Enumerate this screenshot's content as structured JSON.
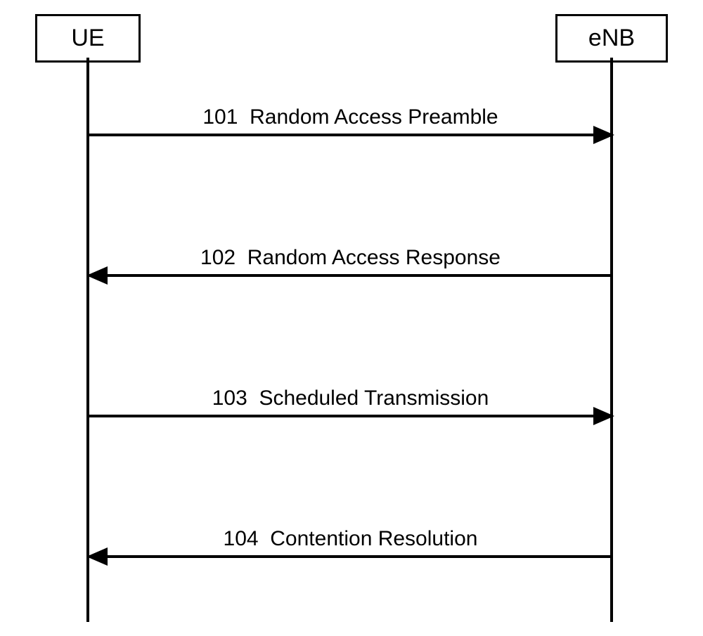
{
  "actors": {
    "ue": "UE",
    "enb": "eNB"
  },
  "messages": [
    {
      "num": "101",
      "label": "Random Access Preamble",
      "direction": "right"
    },
    {
      "num": "102",
      "label": "Random Access Response",
      "direction": "left"
    },
    {
      "num": "103",
      "label": "Scheduled Transmission",
      "direction": "right"
    },
    {
      "num": "104",
      "label": "Contention Resolution",
      "direction": "left"
    }
  ],
  "chart_data": {
    "type": "sequence-diagram",
    "title": "",
    "actors": [
      "UE",
      "eNB"
    ],
    "messages": [
      {
        "from": "UE",
        "to": "eNB",
        "step": 101,
        "label": "Random Access Preamble"
      },
      {
        "from": "eNB",
        "to": "UE",
        "step": 102,
        "label": "Random Access Response"
      },
      {
        "from": "UE",
        "to": "eNB",
        "step": 103,
        "label": "Scheduled Transmission"
      },
      {
        "from": "eNB",
        "to": "UE",
        "step": 104,
        "label": "Contention Resolution"
      }
    ]
  }
}
